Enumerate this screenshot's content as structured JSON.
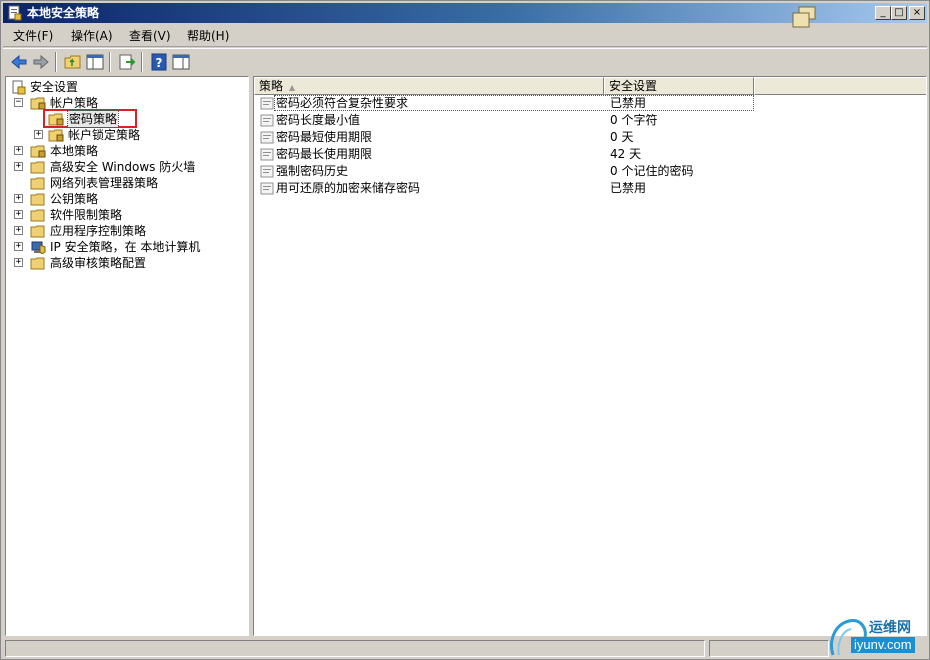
{
  "window": {
    "title": "本地安全策略"
  },
  "menu": [
    {
      "label": "文件(F)"
    },
    {
      "label": "操作(A)"
    },
    {
      "label": "查看(V)"
    },
    {
      "label": "帮助(H)"
    }
  ],
  "toolbar": {
    "icons": [
      "back-arrow-icon",
      "forward-arrow-icon",
      "up-folder-icon",
      "show-hide-console-tree-icon",
      "export-list-icon",
      "help-icon",
      "properties-icon"
    ]
  },
  "tree": {
    "root": "安全设置",
    "account_policy": "帐户策略",
    "password_policy": "密码策略",
    "lockout_policy": "帐户锁定策略",
    "local_policy": "本地策略",
    "firewall": "高级安全 Windows 防火墙",
    "network_list": "网络列表管理器策略",
    "public_key": "公钥策略",
    "software_restriction": "软件限制策略",
    "app_control": "应用程序控制策略",
    "ip_security": "IP 安全策略，在 本地计算机",
    "audit": "高级审核策略配置"
  },
  "list": {
    "col_policy": "策略",
    "col_setting": "安全设置",
    "rows": [
      {
        "name": "密码必须符合复杂性要求",
        "value": "已禁用"
      },
      {
        "name": "密码长度最小值",
        "value": "0 个字符"
      },
      {
        "name": "密码最短使用期限",
        "value": "0 天"
      },
      {
        "name": "密码最长使用期限",
        "value": "42 天"
      },
      {
        "name": "强制密码历史",
        "value": "0 个记住的密码"
      },
      {
        "name": "用可还原的加密来储存密码",
        "value": "已禁用"
      }
    ]
  },
  "watermark": {
    "line1": "运维网",
    "line2": "iyunv.com"
  },
  "colors": {
    "title_bar": "#0a246a",
    "highlight_box": "#e02020",
    "selection": "#e8e8e8"
  }
}
